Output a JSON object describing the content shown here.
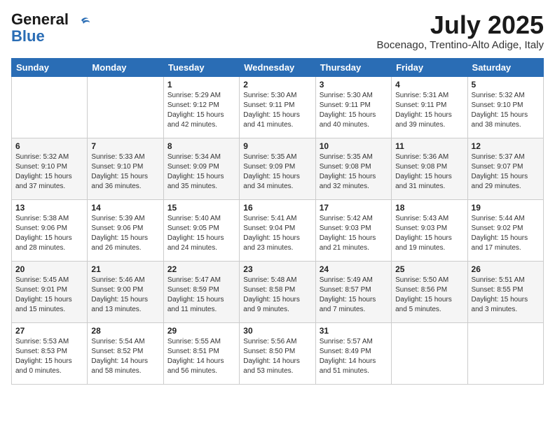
{
  "header": {
    "logo_general": "General",
    "logo_blue": "Blue",
    "month_year": "July 2025",
    "location": "Bocenago, Trentino-Alto Adige, Italy"
  },
  "days_of_week": [
    "Sunday",
    "Monday",
    "Tuesday",
    "Wednesday",
    "Thursday",
    "Friday",
    "Saturday"
  ],
  "weeks": [
    [
      {
        "day": "",
        "content": ""
      },
      {
        "day": "",
        "content": ""
      },
      {
        "day": "1",
        "content": "Sunrise: 5:29 AM\nSunset: 9:12 PM\nDaylight: 15 hours and 42 minutes."
      },
      {
        "day": "2",
        "content": "Sunrise: 5:30 AM\nSunset: 9:11 PM\nDaylight: 15 hours and 41 minutes."
      },
      {
        "day": "3",
        "content": "Sunrise: 5:30 AM\nSunset: 9:11 PM\nDaylight: 15 hours and 40 minutes."
      },
      {
        "day": "4",
        "content": "Sunrise: 5:31 AM\nSunset: 9:11 PM\nDaylight: 15 hours and 39 minutes."
      },
      {
        "day": "5",
        "content": "Sunrise: 5:32 AM\nSunset: 9:10 PM\nDaylight: 15 hours and 38 minutes."
      }
    ],
    [
      {
        "day": "6",
        "content": "Sunrise: 5:32 AM\nSunset: 9:10 PM\nDaylight: 15 hours and 37 minutes."
      },
      {
        "day": "7",
        "content": "Sunrise: 5:33 AM\nSunset: 9:10 PM\nDaylight: 15 hours and 36 minutes."
      },
      {
        "day": "8",
        "content": "Sunrise: 5:34 AM\nSunset: 9:09 PM\nDaylight: 15 hours and 35 minutes."
      },
      {
        "day": "9",
        "content": "Sunrise: 5:35 AM\nSunset: 9:09 PM\nDaylight: 15 hours and 34 minutes."
      },
      {
        "day": "10",
        "content": "Sunrise: 5:35 AM\nSunset: 9:08 PM\nDaylight: 15 hours and 32 minutes."
      },
      {
        "day": "11",
        "content": "Sunrise: 5:36 AM\nSunset: 9:08 PM\nDaylight: 15 hours and 31 minutes."
      },
      {
        "day": "12",
        "content": "Sunrise: 5:37 AM\nSunset: 9:07 PM\nDaylight: 15 hours and 29 minutes."
      }
    ],
    [
      {
        "day": "13",
        "content": "Sunrise: 5:38 AM\nSunset: 9:06 PM\nDaylight: 15 hours and 28 minutes."
      },
      {
        "day": "14",
        "content": "Sunrise: 5:39 AM\nSunset: 9:06 PM\nDaylight: 15 hours and 26 minutes."
      },
      {
        "day": "15",
        "content": "Sunrise: 5:40 AM\nSunset: 9:05 PM\nDaylight: 15 hours and 24 minutes."
      },
      {
        "day": "16",
        "content": "Sunrise: 5:41 AM\nSunset: 9:04 PM\nDaylight: 15 hours and 23 minutes."
      },
      {
        "day": "17",
        "content": "Sunrise: 5:42 AM\nSunset: 9:03 PM\nDaylight: 15 hours and 21 minutes."
      },
      {
        "day": "18",
        "content": "Sunrise: 5:43 AM\nSunset: 9:03 PM\nDaylight: 15 hours and 19 minutes."
      },
      {
        "day": "19",
        "content": "Sunrise: 5:44 AM\nSunset: 9:02 PM\nDaylight: 15 hours and 17 minutes."
      }
    ],
    [
      {
        "day": "20",
        "content": "Sunrise: 5:45 AM\nSunset: 9:01 PM\nDaylight: 15 hours and 15 minutes."
      },
      {
        "day": "21",
        "content": "Sunrise: 5:46 AM\nSunset: 9:00 PM\nDaylight: 15 hours and 13 minutes."
      },
      {
        "day": "22",
        "content": "Sunrise: 5:47 AM\nSunset: 8:59 PM\nDaylight: 15 hours and 11 minutes."
      },
      {
        "day": "23",
        "content": "Sunrise: 5:48 AM\nSunset: 8:58 PM\nDaylight: 15 hours and 9 minutes."
      },
      {
        "day": "24",
        "content": "Sunrise: 5:49 AM\nSunset: 8:57 PM\nDaylight: 15 hours and 7 minutes."
      },
      {
        "day": "25",
        "content": "Sunrise: 5:50 AM\nSunset: 8:56 PM\nDaylight: 15 hours and 5 minutes."
      },
      {
        "day": "26",
        "content": "Sunrise: 5:51 AM\nSunset: 8:55 PM\nDaylight: 15 hours and 3 minutes."
      }
    ],
    [
      {
        "day": "27",
        "content": "Sunrise: 5:53 AM\nSunset: 8:53 PM\nDaylight: 15 hours and 0 minutes."
      },
      {
        "day": "28",
        "content": "Sunrise: 5:54 AM\nSunset: 8:52 PM\nDaylight: 14 hours and 58 minutes."
      },
      {
        "day": "29",
        "content": "Sunrise: 5:55 AM\nSunset: 8:51 PM\nDaylight: 14 hours and 56 minutes."
      },
      {
        "day": "30",
        "content": "Sunrise: 5:56 AM\nSunset: 8:50 PM\nDaylight: 14 hours and 53 minutes."
      },
      {
        "day": "31",
        "content": "Sunrise: 5:57 AM\nSunset: 8:49 PM\nDaylight: 14 hours and 51 minutes."
      },
      {
        "day": "",
        "content": ""
      },
      {
        "day": "",
        "content": ""
      }
    ]
  ]
}
